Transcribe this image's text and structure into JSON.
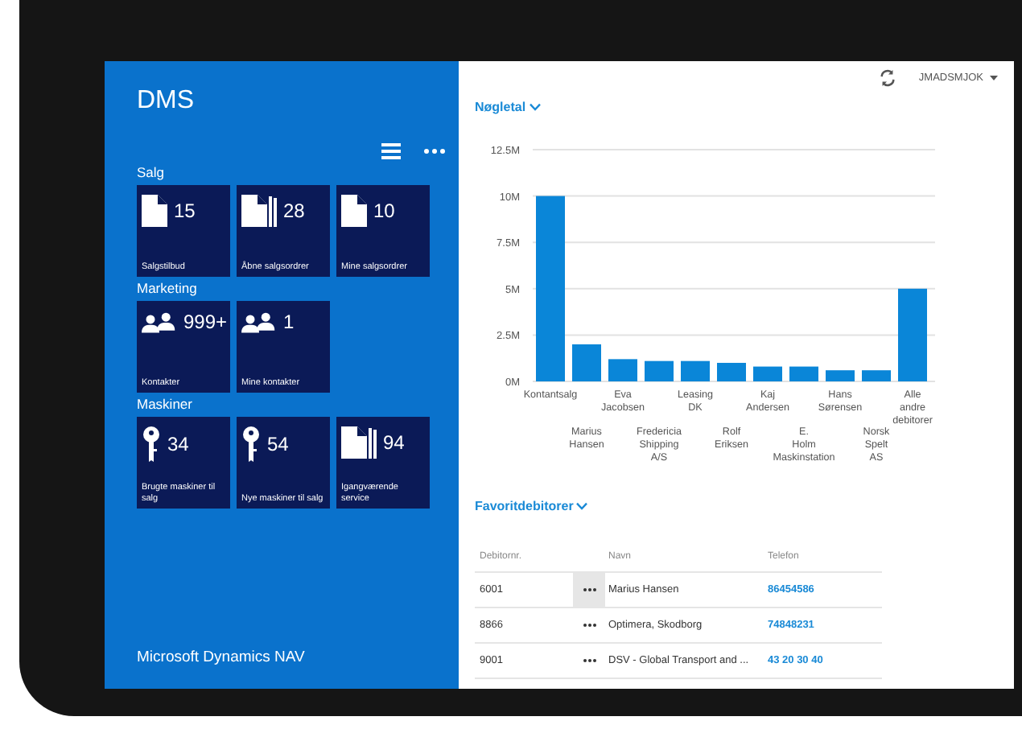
{
  "app": {
    "title": "DMS",
    "footer": "Microsoft Dynamics NAV"
  },
  "groups": [
    {
      "title": "Salg",
      "tiles": [
        {
          "kind": "document",
          "count": "15",
          "label": "Salgstilbud"
        },
        {
          "kind": "documents",
          "count": "28",
          "label": "Åbne salgsordrer"
        },
        {
          "kind": "document",
          "count": "10",
          "label": "Mine salgsordrer"
        }
      ]
    },
    {
      "title": "Marketing",
      "tiles": [
        {
          "kind": "people",
          "count": "999+",
          "label": "Kontakter"
        },
        {
          "kind": "people",
          "count": "1",
          "label": "Mine kontakter"
        }
      ]
    },
    {
      "title": "Maskiner",
      "tiles": [
        {
          "kind": "key",
          "count": "34",
          "label": "Brugte maskiner til salg"
        },
        {
          "kind": "key",
          "count": "54",
          "label": "Nye maskiner til salg"
        },
        {
          "kind": "documents",
          "count": "94",
          "label": "Igangværende service"
        }
      ]
    }
  ],
  "user": "JMADSMJOK",
  "kpi": {
    "title": "Nøgletal",
    "chart_data": {
      "type": "bar",
      "categories": [
        "Kontantsalg",
        "Marius Hansen",
        "Eva Jacobsen",
        "Fredericia Shipping A/S",
        "Leasing DK",
        "Rolf Eriksen",
        "Kaj Andersen",
        "E. Holm Maskinstation",
        "Hans Sørensen",
        "Norsk Spelt AS",
        "Alle andre debitorer"
      ],
      "series": [
        {
          "color": "#0a86d8",
          "values": [
            10000000,
            2000000,
            1200000,
            1100000,
            1100000,
            1000000,
            800000,
            800000,
            600000,
            600000,
            5000000
          ]
        }
      ],
      "grid": true,
      "ylim": [
        0,
        12500000
      ],
      "yticks": [
        {
          "value": 0,
          "label": "0M"
        },
        {
          "value": 2500000,
          "label": "2.5M"
        },
        {
          "value": 5000000,
          "label": "5M"
        },
        {
          "value": 7500000,
          "label": "7.5M"
        },
        {
          "value": 10000000,
          "label": "10M"
        },
        {
          "value": 12500000,
          "label": "12.5M"
        }
      ]
    }
  },
  "favorites": {
    "title": "Favoritdebitorer",
    "columns": [
      "Debitornr.",
      "Navn",
      "Telefon"
    ],
    "rows": [
      {
        "number": "6001",
        "name": "Marius Hansen",
        "phone": "86454586",
        "selected": true
      },
      {
        "number": "8866",
        "name": "Optimera, Skodborg",
        "phone": "74848231",
        "selected": false
      },
      {
        "number": "9001",
        "name": "DSV - Global Transport and ...",
        "phone": "43 20 30 40",
        "selected": false
      }
    ]
  }
}
